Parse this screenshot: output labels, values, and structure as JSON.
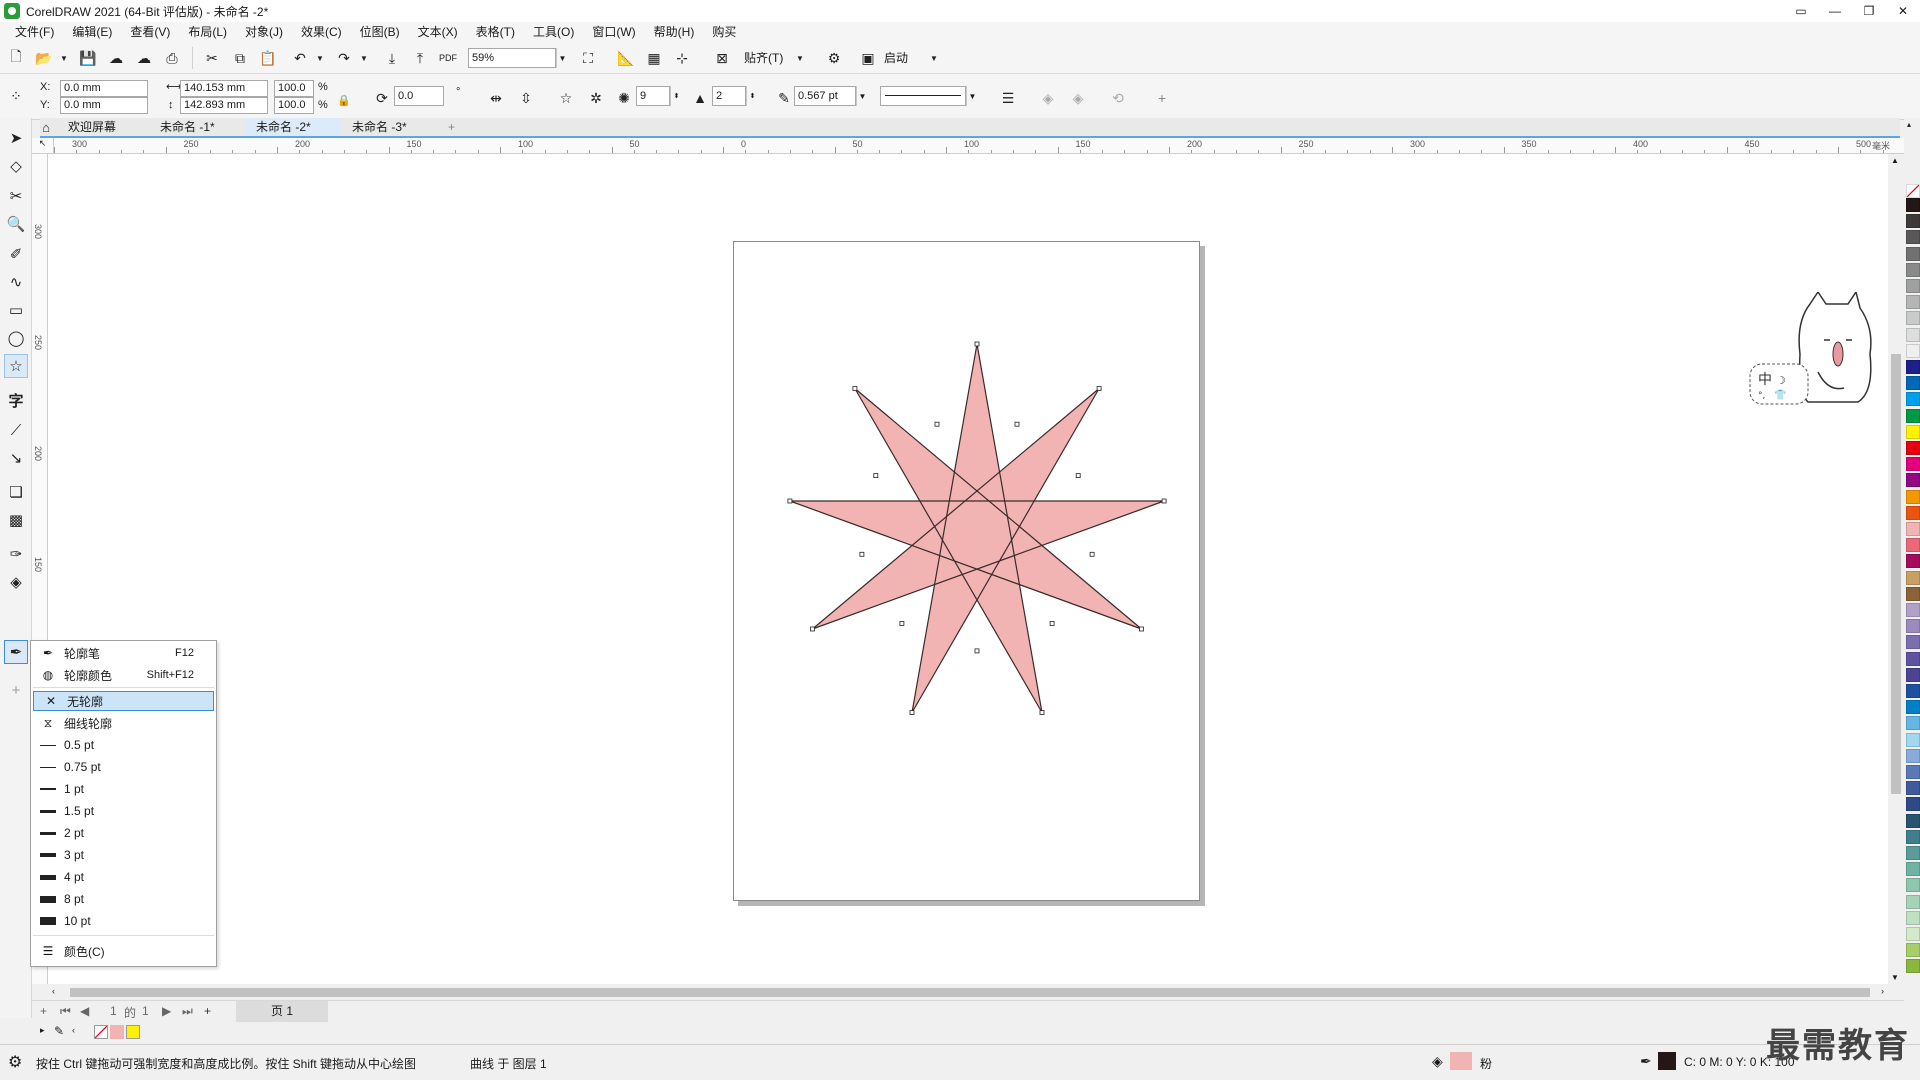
{
  "window": {
    "title": "CorelDRAW 2021 (64-Bit 评估版) - 未命名 -2*",
    "controls": [
      "▭",
      "—",
      "❐",
      "✕"
    ]
  },
  "menu": [
    "文件(F)",
    "编辑(E)",
    "查看(V)",
    "布局(L)",
    "对象(J)",
    "效果(C)",
    "位图(B)",
    "文本(X)",
    "表格(T)",
    "工具(O)",
    "窗口(W)",
    "帮助(H)",
    "购买"
  ],
  "standard_toolbar": {
    "pdf_label": "PDF",
    "zoom_value": "59%",
    "snap_label": "贴齐(T)",
    "launch_label": "启动"
  },
  "property_bar": {
    "x_label": "X:",
    "x_value": "0.0 mm",
    "y_label": "Y:",
    "y_value": "0.0 mm",
    "width_value": "140.153 mm",
    "height_value": "142.893 mm",
    "scale_x": "100.0",
    "scale_y": "100.0",
    "percent": "%",
    "rotation_value": "0.0",
    "degree_symbol": "°",
    "points_value": "9",
    "sharpness_value": "2",
    "outline_width": "0.567 pt"
  },
  "tabs": [
    {
      "label": "欢迎屏幕",
      "active": false
    },
    {
      "label": "未命名 -1*",
      "active": false
    },
    {
      "label": "未命名 -2*",
      "active": true
    },
    {
      "label": "未命名 -3*",
      "active": false
    }
  ],
  "add_tab_label": "+",
  "ruler": {
    "h_labels": [
      "300",
      "250",
      "200",
      "150",
      "100",
      "50",
      "0",
      "50",
      "100",
      "150",
      "200",
      "250",
      "300",
      "350",
      "400",
      "450",
      "500"
    ],
    "h_unit": "毫米",
    "v_labels": [
      "300",
      "250",
      "200",
      "150"
    ]
  },
  "star": {
    "fill_color": "#f2b3b3",
    "stroke_color": "#3a2a2a",
    "points": 9,
    "sharpness": 2
  },
  "outline_flyout": {
    "items": [
      {
        "icon": "pen-icon",
        "label": "轮廓笔",
        "shortcut": "F12"
      },
      {
        "icon": "outline-color-icon",
        "label": "轮廓颜色",
        "shortcut": "Shift+F12"
      },
      {
        "icon": "no-outline-icon",
        "label": "无轮廓",
        "shortcut": "",
        "selected": true
      },
      {
        "icon": "hairline-icon",
        "label": "细线轮廓",
        "shortcut": ""
      },
      {
        "icon": "line-weight-icon",
        "label": "0.5 pt",
        "shortcut": ""
      },
      {
        "icon": "line-weight-icon",
        "label": "0.75 pt",
        "shortcut": ""
      },
      {
        "icon": "line-weight-icon",
        "label": "1 pt",
        "shortcut": ""
      },
      {
        "icon": "line-weight-icon",
        "label": "1.5 pt",
        "shortcut": ""
      },
      {
        "icon": "line-weight-icon",
        "label": "2 pt",
        "shortcut": ""
      },
      {
        "icon": "line-weight-icon",
        "label": "3 pt",
        "shortcut": ""
      },
      {
        "icon": "line-weight-icon",
        "label": "4 pt",
        "shortcut": ""
      },
      {
        "icon": "line-weight-icon",
        "label": "8 pt",
        "shortcut": ""
      },
      {
        "icon": "line-weight-icon",
        "label": "10 pt",
        "shortcut": ""
      },
      {
        "icon": "color-settings-icon",
        "label": "颜色(C)",
        "shortcut": ""
      }
    ]
  },
  "page_nav": {
    "current": "1",
    "of_label": "的",
    "total": "1",
    "page_tab": "页 1"
  },
  "status": {
    "hint": "按住 Ctrl 键拖动可强制宽度和高度成比例。按住 Shift 键拖动从中心绘图",
    "object_info": "曲线 于 图层 1",
    "fill_name": "粉",
    "fill_color": "#f2b3b3",
    "outline_color": "#231815",
    "cmyk": "C: 0 M: 0 Y: 0 K: 100"
  },
  "palette_colors": [
    "#ffffff",
    "#231815",
    "#3e3a39",
    "#595757",
    "#727171",
    "#898989",
    "#9fa0a0",
    "#b5b5b6",
    "#c9caca",
    "#dcdddd",
    "#efefef",
    "#1d2088",
    "#0068b7",
    "#00a0e9",
    "#009944",
    "#fff100",
    "#e60012",
    "#e4007f",
    "#920783",
    "#f39800",
    "#ea5514",
    "#f2b3b3",
    "#eb6877",
    "#a40b5d",
    "#c9a063",
    "#8c6239",
    "#b3a0c9",
    "#9b8bbd",
    "#7c6fb0",
    "#5f52a0",
    "#4c4394",
    "#1e50a2",
    "#0080c8",
    "#66b6e4",
    "#a0d8ef",
    "#88abda",
    "#5a7ab6",
    "#3e5b9a",
    "#2e4a86",
    "#28546e",
    "#3f7f8c",
    "#5a9c9a",
    "#6fb3a4",
    "#8fc6b0",
    "#a6d3b8",
    "#c0e0c4",
    "#d3e9c8",
    "#a5cf6b",
    "#8ab83c"
  ],
  "watermark": "最需教育"
}
